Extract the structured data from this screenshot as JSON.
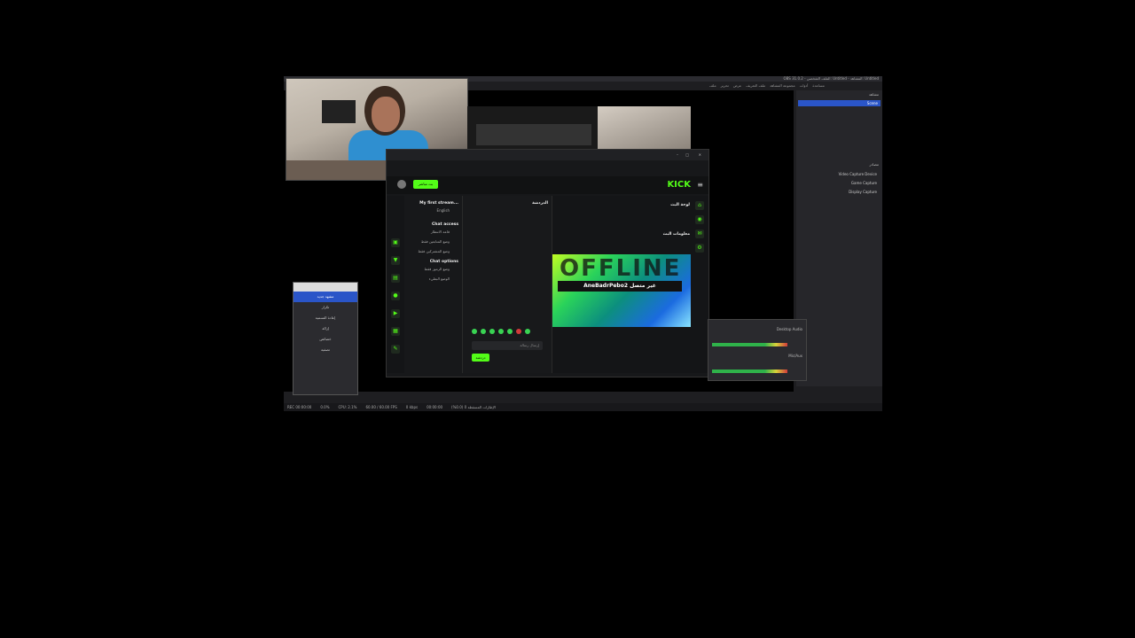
{
  "obs": {
    "title": "OBS 31.0.2 - الملف الشخصي: Untitled - المشاهد: Untitled",
    "menu": [
      "ملف",
      "تحرير",
      "عرض",
      "ملف التعريف",
      "مجموعة المشاهد",
      "أدوات",
      "مساعدة"
    ],
    "scenes_header": "مشاهد",
    "scene_active": "Scene",
    "sources_header": "مصادر",
    "sources": [
      "Video Capture Device",
      "Game Capture",
      "Display Capture"
    ],
    "status": [
      "REC 00:00:00",
      "0.0%",
      "CPU: 2.1%",
      "60.00 / 60.00 FPS",
      "0 kbps",
      "00:00:00",
      "الإطارات المسقطة 0 (0.0%)"
    ]
  },
  "browser": {
    "tab_label": "Kick",
    "kick_logo": "KICK",
    "go_live_label": "بث مباشر",
    "video_overlay_text": "AneBadrPebo2 غير متصل",
    "offline_text": "OFFLINE",
    "stream_info_title": "معلومات البث",
    "stream_panel_label": "لوحة البث",
    "chat_header": "الدردشة",
    "chat_input_placeholder": "إرسال رسالة",
    "chat_send_label": "دردشة",
    "left_panel_title": "My first stream...",
    "left_panel_lang": "English",
    "chat_access_title": "Chat access",
    "chat_options_title": "Chat options",
    "left_items": [
      "قاعة الانتظار",
      "وضع المتابعين فقط",
      "وضع المشتركين فقط",
      "وضع الرموز فقط",
      "الوضع البطيء"
    ]
  },
  "dialog": {
    "items": [
      "مشهد جديد",
      "تكرار",
      "إعادة التسمية",
      "إزالة",
      "خصائص",
      "تصفية"
    ],
    "active_index": 0
  },
  "mixer": {
    "channels": [
      "Desktop Audio",
      "Mic/Aux"
    ],
    "levels": [
      0.85,
      0.85
    ]
  }
}
